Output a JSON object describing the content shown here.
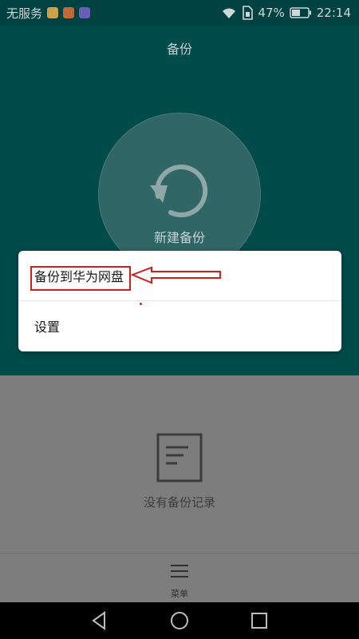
{
  "status_bar": {
    "carrier": "无服务",
    "battery_percent": "47%",
    "time": "22:14",
    "icons": [
      "app-icon-1",
      "app-icon-2",
      "app-icon-3",
      "wifi-icon",
      "sim-icon",
      "battery-icon"
    ]
  },
  "header": {
    "title": "备份"
  },
  "backup_button": {
    "label": "新建备份",
    "icon": "refresh-icon"
  },
  "popup_menu": {
    "items": [
      {
        "label": "备份到华为网盘"
      },
      {
        "label": "设置"
      }
    ]
  },
  "empty_state": {
    "icon": "document-icon",
    "text": "没有备份记录"
  },
  "bottom_menu": {
    "icon": "menu-icon",
    "label": "菜单"
  },
  "nav_bar": {
    "buttons": [
      "back-icon",
      "home-icon",
      "recents-icon"
    ]
  },
  "colors": {
    "teal_bg": "#014b4b",
    "status_bg": "#004242",
    "dim_bg": "#7d7d7d",
    "annotation_red": "#d31c1c"
  }
}
